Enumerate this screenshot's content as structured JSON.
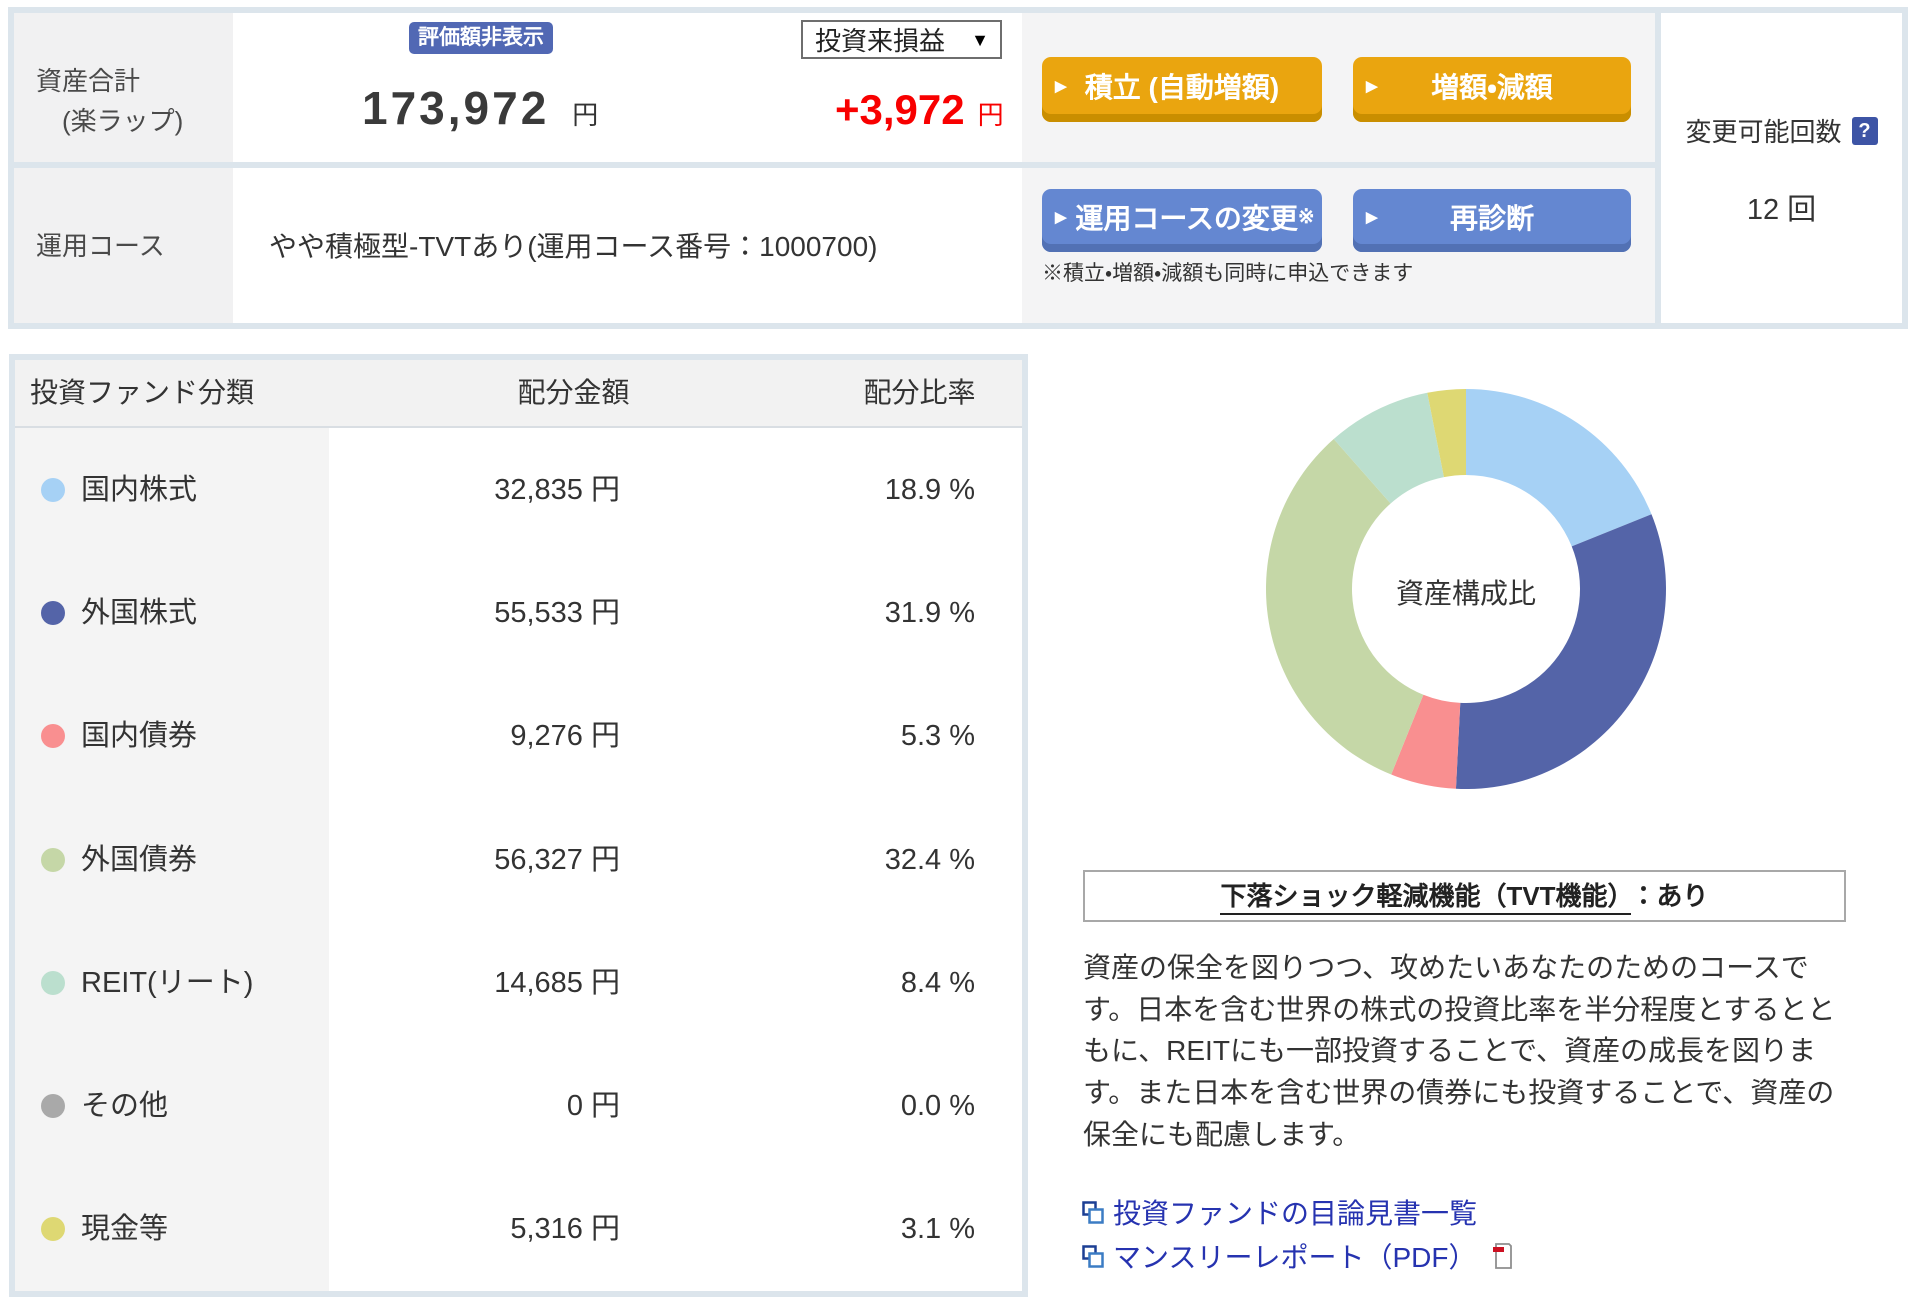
{
  "summary": {
    "row1_label_line1": "資産合計",
    "row1_label_line2": "(楽ラップ)",
    "hide_badge": "評価額非表示",
    "total_amount": "173,972",
    "total_unit": "円",
    "pl_select_label": "投資来損益",
    "pl_select_arrow": "▼",
    "pl_value": "+3,972",
    "pl_unit": "円",
    "row2_label": "運用コース",
    "course_name": "やや積極型-TVTあり(運用コース番号：1000700)",
    "btn_tsumitate": "積立 (自動増額)",
    "btn_zougaku": "増額・減額",
    "btn_course_change": "運用コースの変更",
    "btn_course_change_mark": "※",
    "btn_rediagnosis": "再診断",
    "note": "※積立・増額・減額も同時に申込できます",
    "button_arrow": "▶",
    "change_count_label": "変更可能回数",
    "help_icon": "?",
    "change_count_value": "12 回"
  },
  "allocation_table": {
    "header_class": "投資ファンド分類",
    "header_amount": "配分金額",
    "header_ratio": "配分比率",
    "rows": [
      {
        "label": "国内株式",
        "amount": "32,835 円",
        "ratio": "18.9 %",
        "color": "#a6d1f5"
      },
      {
        "label": "外国株式",
        "amount": "55,533 円",
        "ratio": "31.9 %",
        "color": "#5464a8"
      },
      {
        "label": "国内債券",
        "amount": "9,276 円",
        "ratio": "5.3 %",
        "color": "#f98f90"
      },
      {
        "label": "外国債券",
        "amount": "56,327 円",
        "ratio": "32.4 %",
        "color": "#c5d7a7"
      },
      {
        "label": "REIT(リート)",
        "amount": "14,685 円",
        "ratio": "8.4 %",
        "color": "#bbdfce"
      },
      {
        "label": "その他",
        "amount": "0 円",
        "ratio": "0.0 %",
        "color": "#a9a9a9"
      },
      {
        "label": "現金等",
        "amount": "5,316 円",
        "ratio": "3.1 %",
        "color": "#ded873"
      }
    ]
  },
  "chart_data": {
    "type": "pie",
    "subtype": "donut",
    "title": "資産構成比",
    "labels": [
      "国内株式",
      "外国株式",
      "国内債券",
      "外国債券",
      "REIT(リート)",
      "その他",
      "現金等"
    ],
    "values": [
      18.9,
      31.9,
      5.3,
      32.4,
      8.4,
      0.0,
      3.1
    ],
    "amounts_yen": [
      32835,
      55533,
      9276,
      56327,
      14685,
      0,
      5316
    ],
    "colors": [
      "#a6d1f5",
      "#5464a8",
      "#f98f90",
      "#c5d7a7",
      "#bbdfce",
      "#a9a9a9",
      "#ded873"
    ],
    "start_angle_deg": 0,
    "direction": "clockwise",
    "legend_position": "none"
  },
  "tvt_box": {
    "underlined": "下落ショック軽減機能（TVT機能）",
    "rest": "：あり"
  },
  "description": "資産の保全を図りつつ、攻めたいあなたのためのコースです。日本を含む世界の株式の投資比率を半分程度とするとともに、REITにも一部投資することで、資産の成長を図ります。また日本を含む世界の債券にも投資することで、資産の保全にも配慮します。",
  "links": [
    {
      "label": "投資ファンドの目論見書一覧"
    },
    {
      "label": "マンスリーレポート（PDF）"
    }
  ]
}
